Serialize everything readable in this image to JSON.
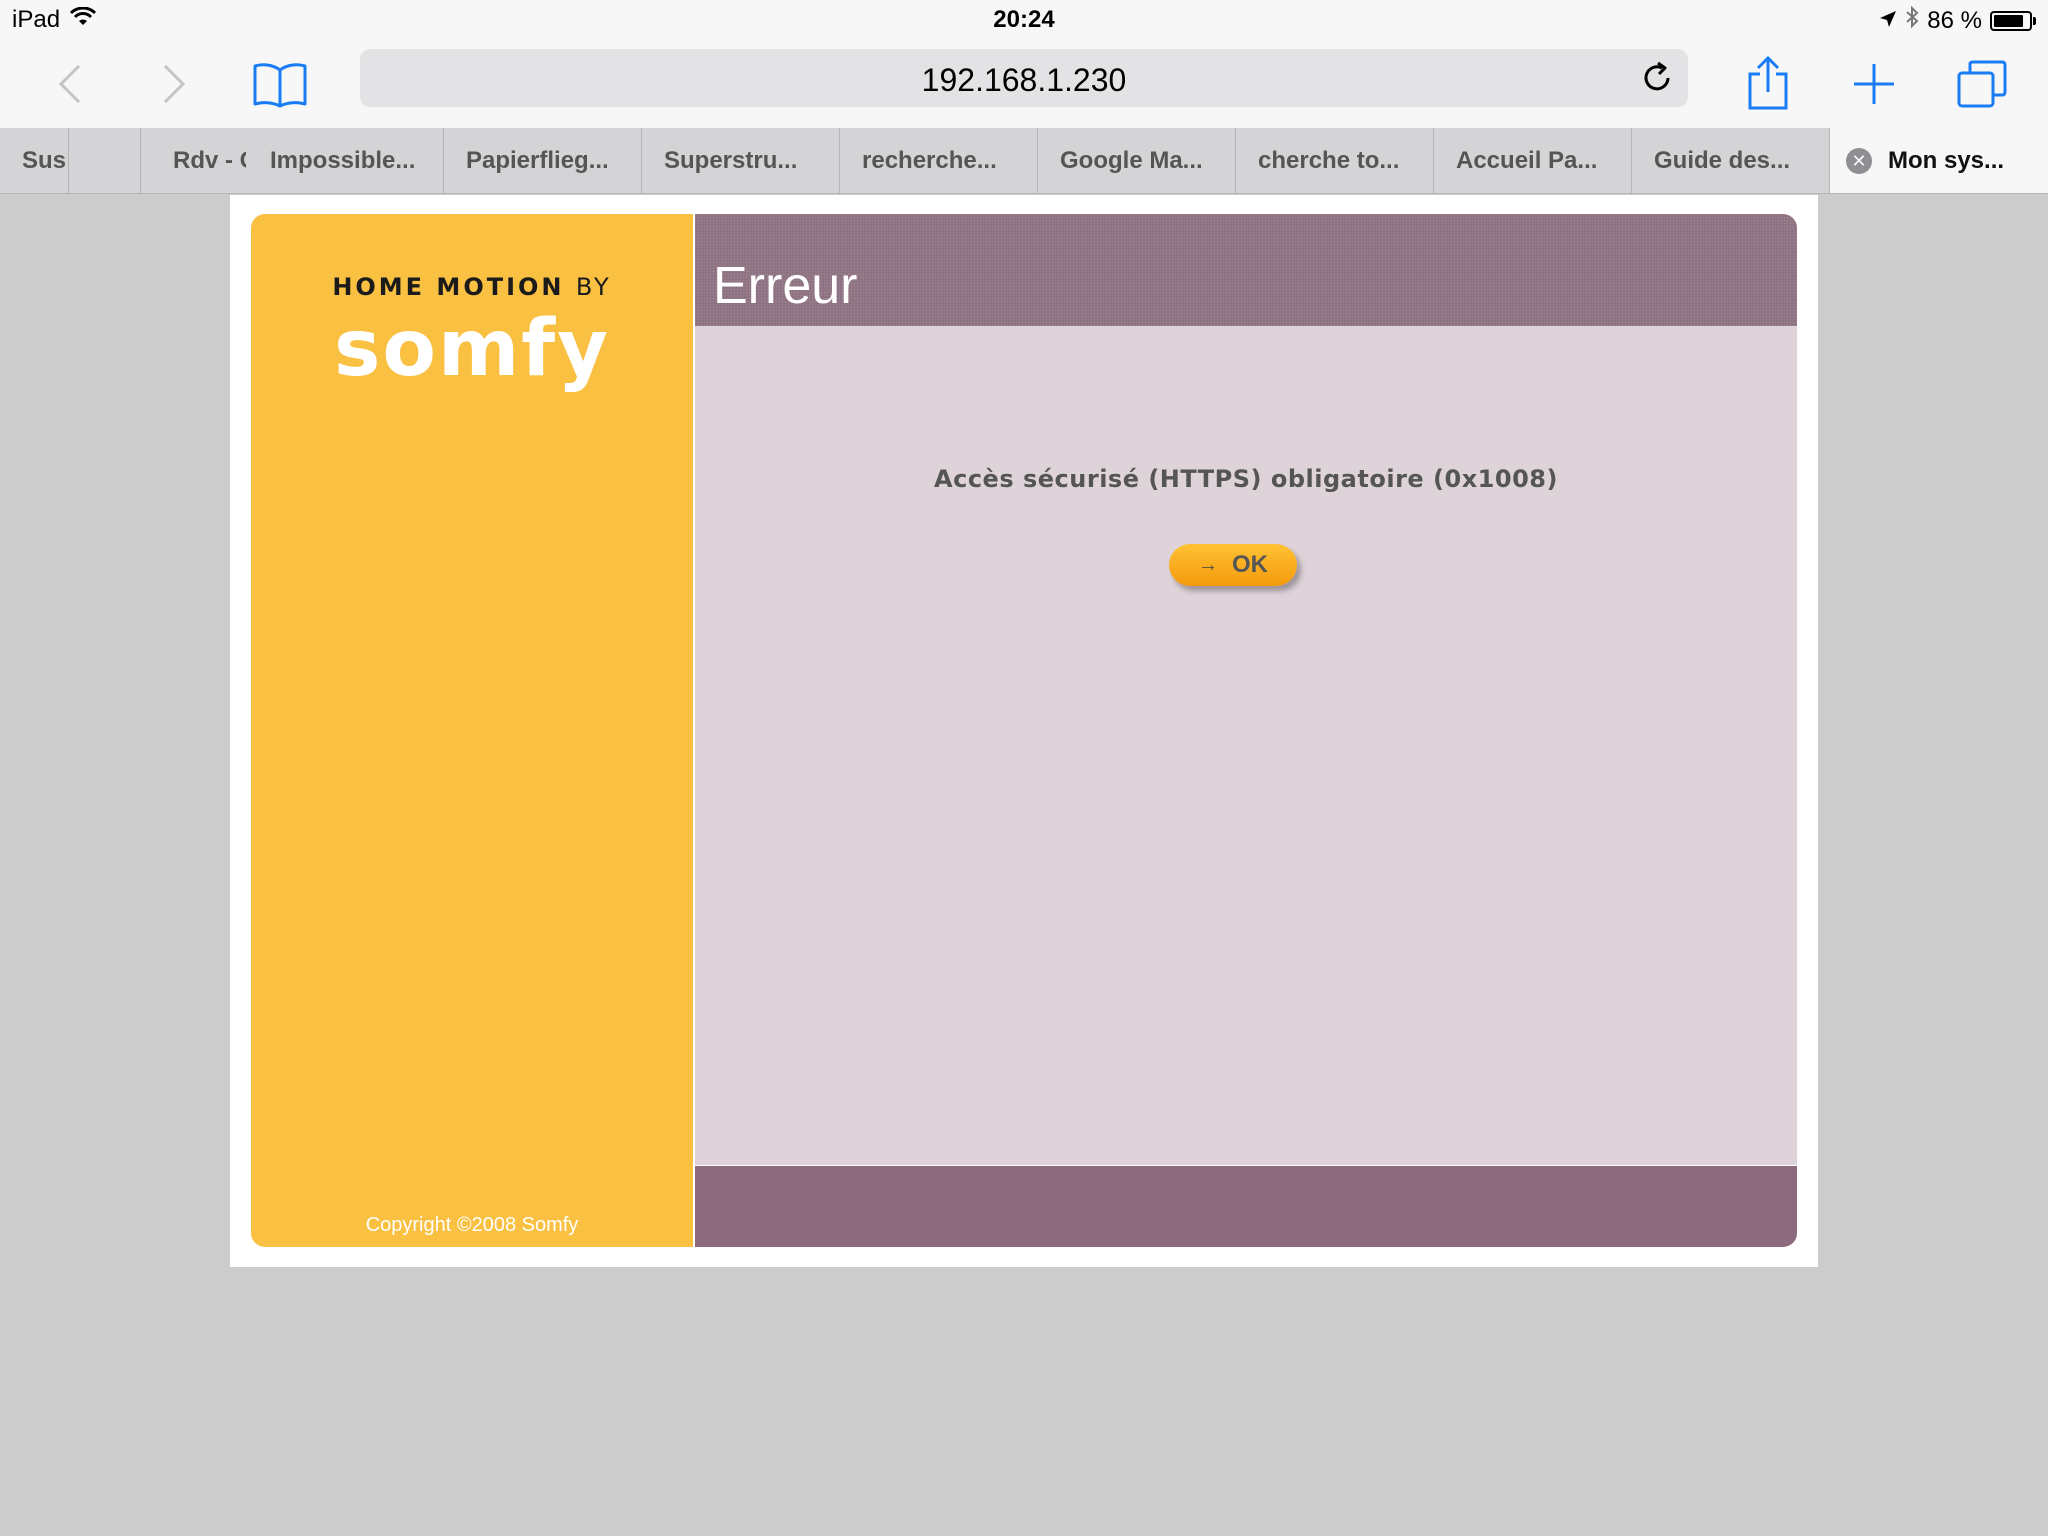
{
  "status_bar": {
    "device": "iPad",
    "time": "20:24",
    "battery": "86 %",
    "battery_level": 0.86
  },
  "toolbar": {
    "url": "192.168.1.230",
    "icons": [
      "back-icon",
      "forward-icon",
      "bookmarks-icon",
      "reload-icon",
      "share-icon",
      "new-tab-icon",
      "tabs-icon"
    ]
  },
  "tabs": [
    {
      "label": "Sus"
    },
    {
      "label": ""
    },
    {
      "label": "Rdv - Gp"
    },
    {
      "label": "Impossible..."
    },
    {
      "label": "Papierflieg..."
    },
    {
      "label": "Superstru..."
    },
    {
      "label": "recherche..."
    },
    {
      "label": "Google Ma..."
    },
    {
      "label": "cherche to..."
    },
    {
      "label": "Accueil Pa..."
    },
    {
      "label": "Guide des..."
    },
    {
      "label": "Mon sys...",
      "active": true
    }
  ],
  "page": {
    "logo_line1": "HOME MOTION",
    "logo_by": "BY",
    "logo_brand": "somfy",
    "copyright": "Copyright ©2008 Somfy",
    "title": "Erreur",
    "message": "Accès sécurisé (HTTPS) obligatoire (0x1008)",
    "ok_label": "OK"
  },
  "colors": {
    "sidebar": "#f9c042",
    "header": "#8d7181",
    "main_bg": "#ded3d9",
    "footer": "#8e6a7e",
    "accent_blue": "#1a7cf5"
  }
}
